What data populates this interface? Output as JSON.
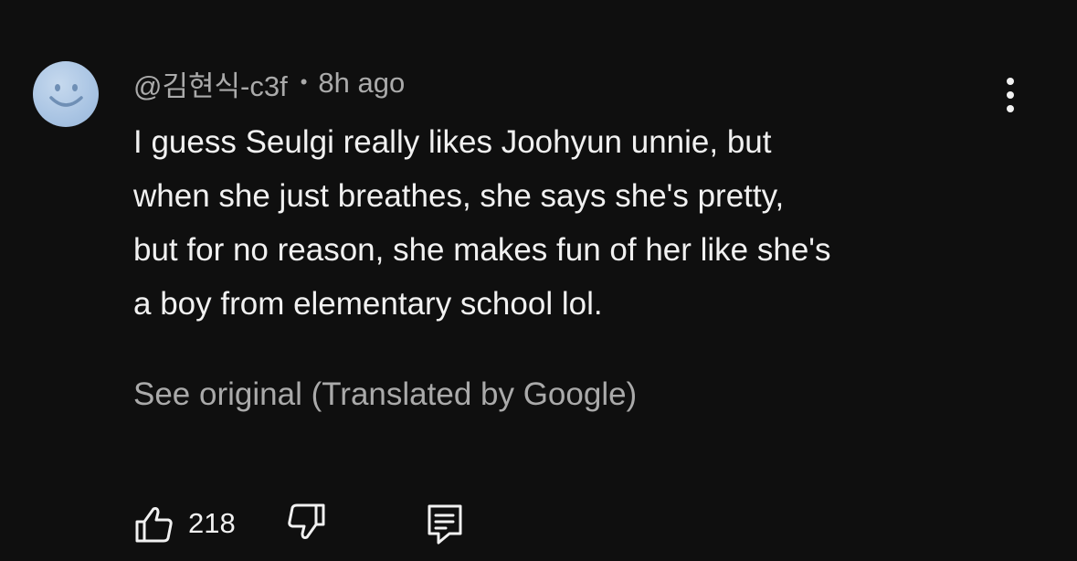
{
  "comment": {
    "author": "@김현식-c3f",
    "separator": "•",
    "timestamp": "8h ago",
    "text": "I guess Seulgi really likes Joohyun unnie, but\nwhen she just breathes, she says she's pretty,\nbut for no reason, she makes fun of her like she's\na boy from elementary school lol.",
    "translation_link": "See original (Translated by Google)",
    "like_count": "218",
    "avatar_icon": "smiley-face-icon"
  },
  "icons": {
    "menu": "more-vertical-icon",
    "like": "thumbs-up-icon",
    "dislike": "thumbs-down-icon",
    "reply": "reply-comment-icon"
  },
  "colors": {
    "background": "#0f0f0f",
    "primary_text": "#f1f1f1",
    "secondary_text": "#aaaaaa",
    "avatar": "#a9c4e3"
  }
}
